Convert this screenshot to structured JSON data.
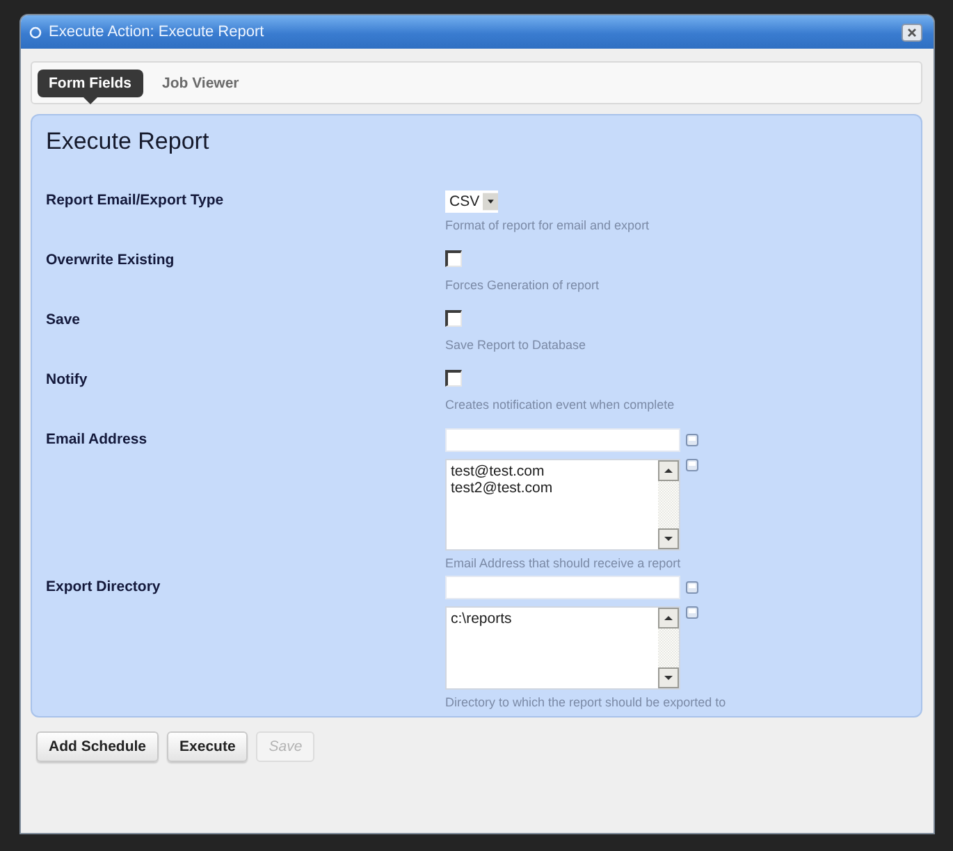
{
  "window": {
    "title": "Execute Action: Execute Report"
  },
  "tabs": [
    {
      "label": "Form Fields",
      "selected": true
    },
    {
      "label": "Job Viewer",
      "selected": false
    }
  ],
  "form": {
    "heading": "Execute Report",
    "fields": [
      {
        "kind": "select",
        "label": "Report Email/Export Type",
        "value": "CSV",
        "hint": "Format of report for email and export"
      },
      {
        "kind": "checkbox",
        "label": "Overwrite Existing",
        "checked": false,
        "hint": "Forces Generation of report"
      },
      {
        "kind": "checkbox",
        "label": "Save",
        "checked": false,
        "hint": "Save Report to Database"
      },
      {
        "kind": "checkbox",
        "label": "Notify",
        "checked": false,
        "hint": "Creates notification event when complete"
      },
      {
        "kind": "list",
        "label": "Email Address",
        "entries": [
          "test@test.com",
          "test2@test.com"
        ],
        "hint": "Email Address that should receive a report"
      },
      {
        "kind": "list",
        "label": "Export Directory",
        "entries": [
          "c:\\reports"
        ],
        "hint": "Directory to which the report should be exported to"
      }
    ]
  },
  "buttons": [
    {
      "label": "Add Schedule",
      "disabled": false
    },
    {
      "label": "Execute",
      "disabled": false
    },
    {
      "label": "Save",
      "disabled": true
    }
  ]
}
